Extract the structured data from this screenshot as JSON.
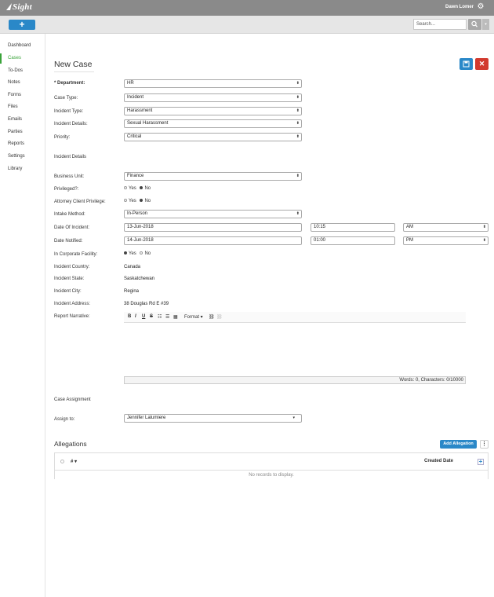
{
  "app": {
    "logo_text": "Sight",
    "user_name": "Dawn Lomer"
  },
  "toolbar": {
    "new_label": "+",
    "search_placeholder": "Search..."
  },
  "sidebar": {
    "items": [
      {
        "label": "Dashboard"
      },
      {
        "label": "Cases"
      },
      {
        "label": "To-Dos"
      },
      {
        "label": "Notes"
      },
      {
        "label": "Forms"
      },
      {
        "label": "Files"
      },
      {
        "label": "Emails"
      },
      {
        "label": "Parties"
      },
      {
        "label": "Reports"
      },
      {
        "label": "Settings"
      },
      {
        "label": "Library"
      }
    ]
  },
  "page": {
    "title": "New Case"
  },
  "form": {
    "department": {
      "label": "* Department:",
      "value": "HR"
    },
    "case_type": {
      "label": "Case Type:",
      "value": "Incident"
    },
    "incident_type": {
      "label": "Incident Type:",
      "value": "Harassment"
    },
    "incident_details": {
      "label": "Incident Details:",
      "value": "Sexual Harassment"
    },
    "priority": {
      "label": "Priority:",
      "value": "Critical"
    },
    "section_incident_details": "Incident Details",
    "business_unit": {
      "label": "Business Unit:",
      "value": "Finance"
    },
    "privileged": {
      "label": "Privileged?:",
      "yes": "Yes",
      "no": "No"
    },
    "attorney_privilege": {
      "label": "Attorney Client Privilege:",
      "yes": "Yes",
      "no": "No"
    },
    "intake_method": {
      "label": "Intake Method:",
      "value": "In-Person"
    },
    "date_of_incident": {
      "label": "Date Of Incident:",
      "date": "13-Jun-2018",
      "time": "10:15",
      "ampm": "AM"
    },
    "date_notified": {
      "label": "Date Notified:",
      "date": "14-Jun-2018",
      "time": "01:00",
      "ampm": "PM"
    },
    "corporate_facility": {
      "label": "In Corporate Facility:",
      "yes": "Yes",
      "no": "No"
    },
    "country": {
      "label": "Incident Country:",
      "value": "Canada"
    },
    "state": {
      "label": "Incident State:",
      "value": "Saskatchewan"
    },
    "city": {
      "label": "Incident City:",
      "value": "Regina"
    },
    "address": {
      "label": "Incident Address:",
      "value": "38 Douglas Rd E #39"
    },
    "narrative": {
      "label": "Report Narrative:",
      "format_label": "Format",
      "status": "Words: 0, Characters: 0/10000"
    },
    "section_case_assignment": "Case Assignment",
    "assign_to": {
      "label": "Assign to:",
      "value": "Jennifer Lalumiere"
    }
  },
  "allegations": {
    "title": "Allegations",
    "add_label": "Add Allegation",
    "more_label": "⋮",
    "columns": [
      "# ▾",
      "Created Date"
    ],
    "empty_text": "No records to display."
  }
}
